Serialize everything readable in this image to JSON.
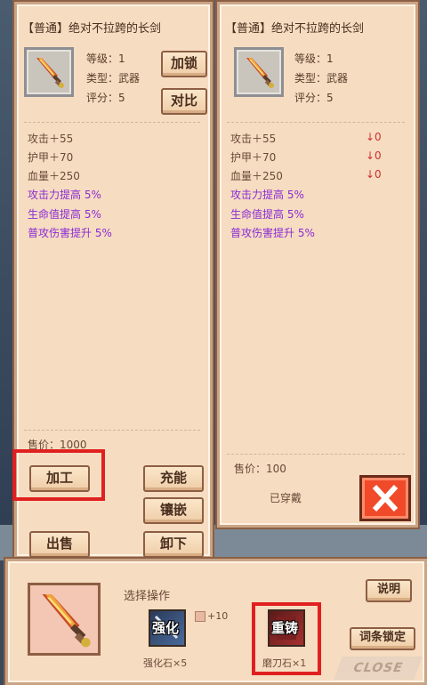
{
  "left": {
    "title": "【普通】绝对不拉跨的长剑",
    "level": "等级：1",
    "type": "类型：武器",
    "score": "评分：5",
    "lock_btn": "加锁",
    "compare_btn": "对比",
    "stats": [
      "攻击＋55",
      "护甲＋70",
      "血量＋250"
    ],
    "bonuses": [
      "攻击力提高 5%",
      "生命值提高 5%",
      "普攻伤害提升 5%"
    ],
    "price": "售价：1000",
    "process_btn": "加工",
    "charge_btn": "充能",
    "inlay_btn": "镶嵌",
    "sell_btn": "出售",
    "unequip_btn": "卸下"
  },
  "right": {
    "title": "【普通】绝对不拉跨的长剑",
    "level": "等级：1",
    "type": "类型：武器",
    "score": "评分：5",
    "stats": [
      "攻击＋55",
      "护甲＋70",
      "血量＋250"
    ],
    "diffs": [
      "↓0",
      "↓0",
      "↓0"
    ],
    "bonuses": [
      "攻击力提高 5%",
      "生命值提高 5%",
      "普攻伤害提升 5%"
    ],
    "price": "售价：100",
    "equipped": "已穿戴"
  },
  "bottom": {
    "label": "选择操作",
    "help_btn": "说明",
    "enhance_label": "强化",
    "enhance_cost": "强化石×5",
    "plus_text": "+10",
    "reforge_label": "重铸",
    "reforge_cost": "磨刀石×1",
    "lock_entry_btn": "词条锁定",
    "close_label": "CLOSE"
  },
  "colors": {
    "panel": "#f6dcc0",
    "border": "#8c5f44",
    "bonus_text": "#8a2bd6",
    "down_arrow": "#d03030",
    "highlight": "#e02020"
  }
}
